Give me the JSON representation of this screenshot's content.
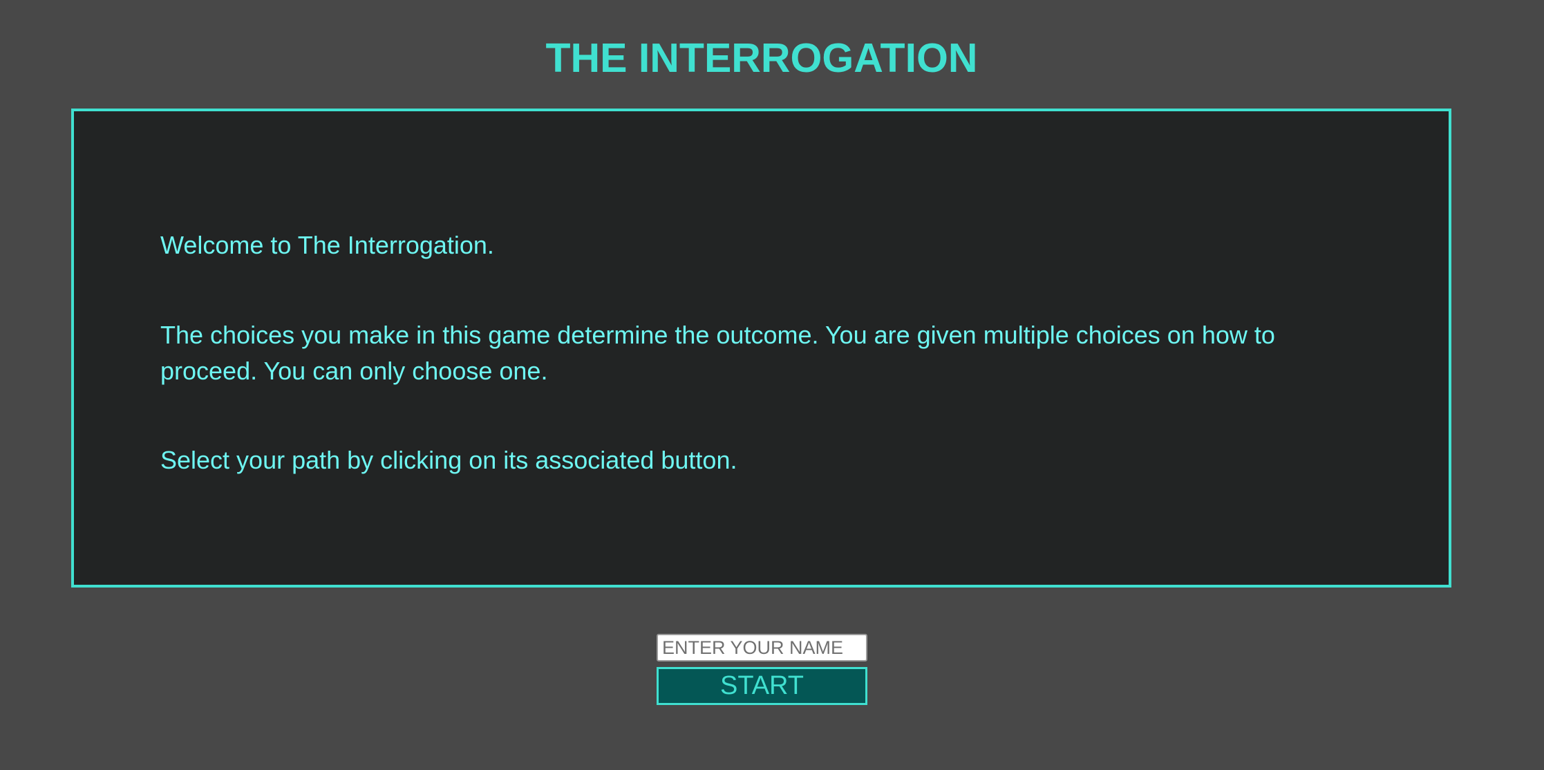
{
  "title": "THE INTERROGATION",
  "intro": {
    "paragraphs": [
      "Welcome to The Interrogation.",
      "The choices you make in this game determine the outcome. You are given multiple choices on how to proceed. You can only choose one.",
      "Select your path by clicking on its associated button."
    ]
  },
  "name_input": {
    "placeholder": "ENTER YOUR NAME",
    "value": ""
  },
  "start_button": {
    "label": "START"
  },
  "colors": {
    "background": "#484848",
    "panel_background": "#222424",
    "accent": "#40e0d0",
    "text": "#6ef6f2",
    "button_background": "#045755"
  }
}
